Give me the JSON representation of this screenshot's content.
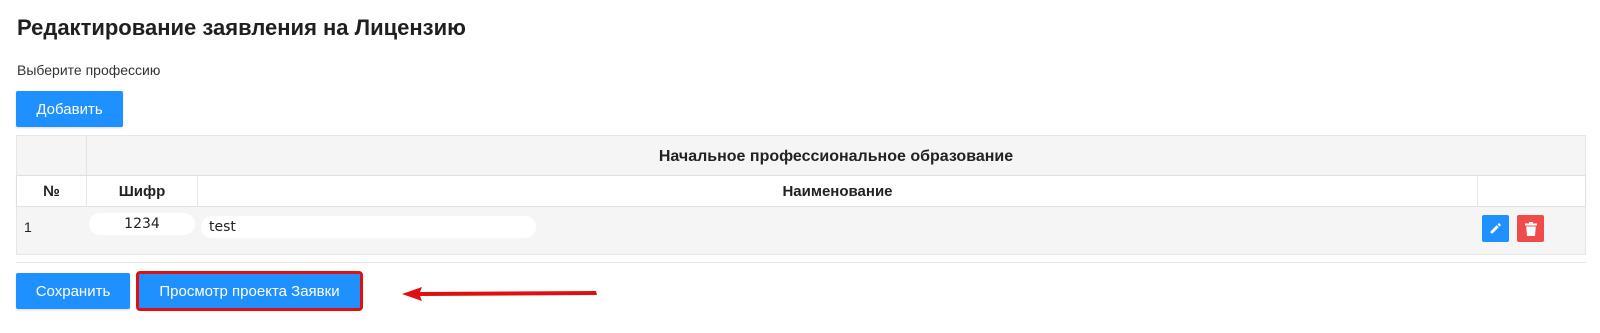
{
  "page": {
    "title": "Редактирование заявления на Лицензию",
    "subtitle": "Выберите профессию"
  },
  "toolbar": {
    "add_label": "Добавить"
  },
  "table": {
    "group_title": "Начальное профессиональное образование",
    "columns": {
      "num": "№",
      "code": "Шифр",
      "name": "Наименование",
      "actions": ""
    },
    "rows": [
      {
        "num": "1",
        "code": "1234",
        "name": "test"
      }
    ]
  },
  "footer": {
    "save_label": "Сохранить",
    "preview_label": "Просмотр проекта Заявки"
  },
  "colors": {
    "primary": "#1e90ff",
    "danger": "#f04b4b",
    "highlight": "#e01010"
  },
  "icons": {
    "edit": "pencil-icon",
    "delete": "trash-icon",
    "pointer": "arrow-left-icon"
  }
}
